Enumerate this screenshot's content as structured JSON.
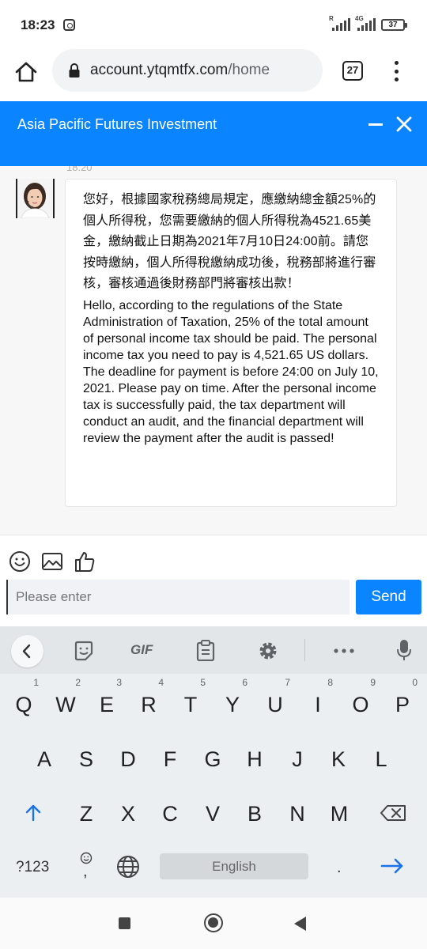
{
  "status_bar": {
    "time": "18:23",
    "network_label": "4G",
    "battery": "37"
  },
  "browser": {
    "url_domain": "account.ytqmtfx.com",
    "url_path": "/home",
    "tab_count": "27"
  },
  "app": {
    "title": "Asia Pacific Futures Investment"
  },
  "chat": {
    "messages": [
      {
        "time": "18:20",
        "text_zh": "您好，根據國家稅務總局規定，應繳納總金額25%的個人所得稅，您需要繳納的個人所得稅為4521.65美金，繳納截止日期為2021年7月10日24:00前。請您按時繳納，個人所得稅繳納成功後，稅務部將進行審核，審核通過後財務部門將審核出款！",
        "text_en": "Hello, according to the regulations of the State Administration of Taxation, 25% of the total amount of personal income tax should be paid. The personal income tax you need to pay is 4,521.65 US dollars. The deadline for payment is before 24:00 on July 10, 2021. Please pay on time. After the personal income tax is successfully paid, the tax department will conduct an audit, and the financial department will review the payment after the audit is passed!"
      }
    ]
  },
  "composer": {
    "placeholder": "Please enter",
    "send_label": "Send"
  },
  "keyboard": {
    "toolbar": {
      "gif_label": "GIF"
    },
    "rows": [
      [
        "Q",
        "W",
        "E",
        "R",
        "T",
        "Y",
        "U",
        "I",
        "O",
        "P"
      ],
      [
        "A",
        "S",
        "D",
        "F",
        "G",
        "H",
        "J",
        "K",
        "L"
      ],
      [
        "Z",
        "X",
        "C",
        "V",
        "B",
        "N",
        "M"
      ]
    ],
    "hints": [
      "1",
      "2",
      "3",
      "4",
      "5",
      "6",
      "7",
      "8",
      "9",
      "0"
    ],
    "symbols_label": "?123",
    "comma_label": ",",
    "space_label": "English",
    "period_label": "."
  },
  "colors": {
    "accent": "#0a84ff"
  }
}
